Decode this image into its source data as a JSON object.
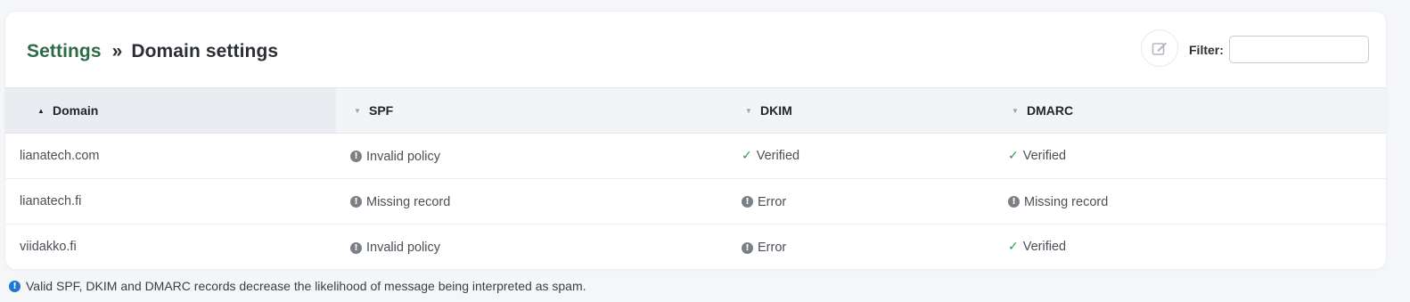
{
  "breadcrumb": {
    "parent": "Settings",
    "separator": "»",
    "current": "Domain settings"
  },
  "toolbar": {
    "edit_icon": "edit-icon",
    "filter_label": "Filter:",
    "filter_value": ""
  },
  "table": {
    "columns": [
      {
        "label": "Domain",
        "sort": "asc"
      },
      {
        "label": "SPF",
        "sort": "none"
      },
      {
        "label": "DKIM",
        "sort": "none"
      },
      {
        "label": "DMARC",
        "sort": "none"
      }
    ],
    "rows": [
      {
        "domain": "lianatech.com",
        "spf": {
          "text": "Invalid policy",
          "status": "warning"
        },
        "dkim": {
          "text": "Verified",
          "status": "ok"
        },
        "dmarc": {
          "text": "Verified",
          "status": "ok"
        }
      },
      {
        "domain": "lianatech.fi",
        "spf": {
          "text": "Missing record",
          "status": "warning"
        },
        "dkim": {
          "text": "Error",
          "status": "warning"
        },
        "dmarc": {
          "text": "Missing record",
          "status": "warning"
        }
      },
      {
        "domain": "viidakko.fi",
        "spf": {
          "text": "Invalid policy",
          "status": "warning"
        },
        "dkim": {
          "text": "Error",
          "status": "warning"
        },
        "dmarc": {
          "text": "Verified",
          "status": "ok"
        }
      }
    ]
  },
  "footnote": "Valid SPF, DKIM and DMARC records decrease the likelihood of message being interpreted as spam.",
  "colors": {
    "brand_green": "#2d6b45",
    "ok_green": "#2e9b4b",
    "warning_gray": "#7b8087",
    "info_blue": "#1f77d4"
  }
}
